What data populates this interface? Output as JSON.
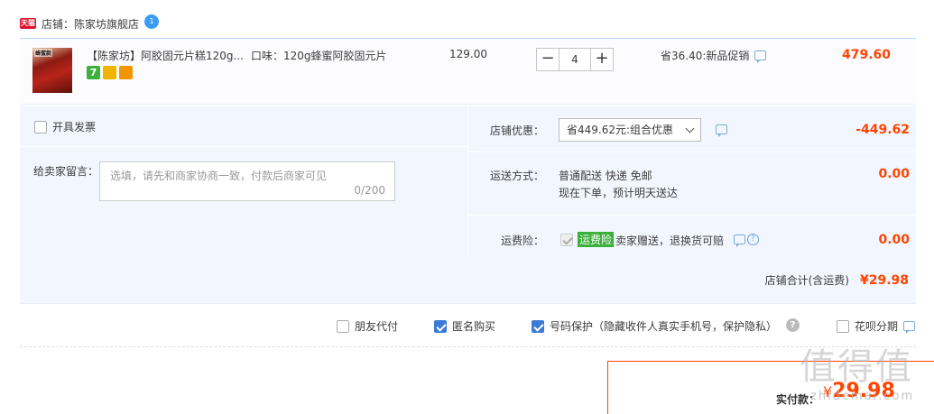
{
  "shop": {
    "badge": "天猫",
    "label": "店铺：陈家坊旗舰店",
    "chat_badge": "1"
  },
  "item": {
    "thumb_text": "蜂蜜款",
    "title": "【陈家坊】阿胶固元片糕120g...",
    "sku": "口味：120g蜂蜜阿胶固元片",
    "price": "129.00",
    "quantity": "4",
    "minus": "−",
    "plus": "+",
    "promo": "省36.40:新品促销",
    "total": "479.60",
    "service_seven": "7"
  },
  "invoice": {
    "label": "开具发票"
  },
  "message": {
    "label": "给卖家留言：",
    "placeholder": "选填，请先和商家协商一致，付款后商家可见",
    "count": "0/200"
  },
  "discount": {
    "label": "店铺优惠：",
    "selected": "省449.62元:组合优惠",
    "value": "-449.62"
  },
  "shipping": {
    "label": "运送方式：",
    "line1": "普通配送 快递 免邮",
    "line2": "现在下单，预计明天送达",
    "value": "0.00"
  },
  "insurance": {
    "label": "运费险：",
    "tag": "运费险",
    "desc": "卖家赠送，退换货可赔",
    "help": "?",
    "value": "0.00"
  },
  "subtotal": {
    "label": "店铺合计(含运费)",
    "value": "¥29.98"
  },
  "options": {
    "friend_pay": "朋友代付",
    "anonymous": "匿名购买",
    "number_protect": "号码保护（隐藏收件人真实手机号，保护隐私）",
    "help": "?",
    "huabei": "花呗分期"
  },
  "pay": {
    "label": "实付款：",
    "currency": "¥",
    "value": "29.98"
  },
  "watermark": {
    "big": "值得值",
    "small": "zhidemai.com"
  },
  "colors": {
    "accent": "#ff4400",
    "detail_bg": "#f2f7ff",
    "checkbox_on": "#3a7bd5",
    "tag_green": "#3cb03c",
    "tmall_red": "#d9162c"
  }
}
